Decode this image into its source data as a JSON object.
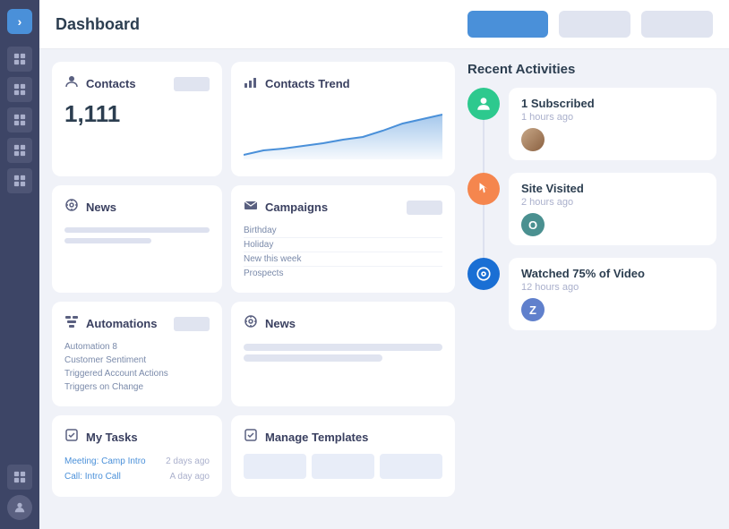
{
  "header": {
    "title": "Dashboard",
    "btn_primary": "",
    "btn_secondary": "",
    "btn_tertiary": ""
  },
  "sidebar": {
    "logo": "›",
    "items": [
      "grid",
      "grid",
      "grid",
      "grid",
      "grid"
    ]
  },
  "contacts": {
    "label": "Contacts",
    "count": "1,111"
  },
  "contacts_trend": {
    "label": "Contacts Trend"
  },
  "news_left": {
    "label": "News"
  },
  "automations": {
    "label": "Automations",
    "items": [
      "Automation 8",
      "Customer Sentiment",
      "Triggered Account Actions",
      "Triggers on Change"
    ]
  },
  "campaigns": {
    "label": "Campaigns",
    "items": [
      "Birthday",
      "Holiday",
      "New this week",
      "Prospects"
    ]
  },
  "news_right": {
    "label": "News"
  },
  "my_tasks": {
    "label": "My Tasks",
    "items": [
      {
        "name": "Meeting: Camp Intro",
        "date": "2 days ago"
      },
      {
        "name": "Call: Intro Call",
        "date": "A day ago"
      }
    ]
  },
  "manage_templates": {
    "label": "Manage Templates"
  },
  "recent": {
    "title": "Recent Activities",
    "activities": [
      {
        "icon": "person",
        "icon_class": "icon-green",
        "title": "1 Subscribed",
        "time": "1 hours ago",
        "avatar_text": "",
        "avatar_class": "av-photo"
      },
      {
        "icon": "cursor",
        "icon_class": "icon-orange",
        "title": "Site Visited",
        "time": "2 hours ago",
        "avatar_text": "O",
        "avatar_class": "av-teal"
      },
      {
        "icon": "eye",
        "icon_class": "icon-blue-dark",
        "title": "Watched 75% of Video",
        "time": "12 hours ago",
        "avatar_text": "Z",
        "avatar_class": "av-blue"
      }
    ]
  }
}
